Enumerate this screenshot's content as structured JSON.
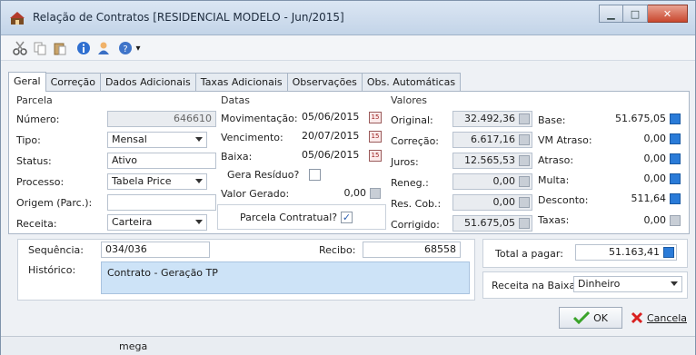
{
  "window": {
    "title": "Relação de Contratos [RESIDENCIAL MODELO - Jun/2015]",
    "controls": {
      "minimize": "▁",
      "maximize": "□",
      "close": "✕"
    }
  },
  "toolbar": {
    "icons": [
      "scissors-icon",
      "copy-icon",
      "paste-icon",
      "info-icon",
      "user-icon",
      "help-icon"
    ],
    "dropdown_glyph": "▾"
  },
  "tabs": [
    "Geral",
    "Correção",
    "Dados Adicionais",
    "Taxas Adicionais",
    "Observações",
    "Obs. Automáticas"
  ],
  "parcela": {
    "title": "Parcela",
    "numero_label": "Número:",
    "numero_value": "646610",
    "tipo_label": "Tipo:",
    "tipo_value": "Mensal",
    "status_label": "Status:",
    "status_value": "Ativo",
    "processo_label": "Processo:",
    "processo_value": "Tabela Price",
    "origem_label": "Origem (Parc.):",
    "origem_value": "",
    "receita_label": "Receita:",
    "receita_value": "Carteira"
  },
  "datas": {
    "title": "Datas",
    "movimentacao_label": "Movimentação:",
    "movimentacao_value": "05/06/2015",
    "vencimento_label": "Vencimento:",
    "vencimento_value": "20/07/2015",
    "baixa_label": "Baixa:",
    "baixa_value": "05/06/2015",
    "gera_residuo_label": "Gera Resíduo?",
    "valor_gerado_label": "Valor Gerado:",
    "valor_gerado_value": "0,00",
    "parcela_contratual_label": "Parcela Contratual?",
    "parcela_contratual_checked": "✓"
  },
  "valores": {
    "title": "Valores",
    "original_label": "Original:",
    "original_value": "32.492,36",
    "correcao_label": "Correção:",
    "correcao_value": "6.617,16",
    "juros_label": "Juros:",
    "juros_value": "12.565,53",
    "reneg_label": "Reneg.:",
    "reneg_value": "0,00",
    "rescob_label": "Res. Cob.:",
    "rescob_value": "0,00",
    "corrigido_label": "Corrigido:",
    "corrigido_value": "51.675,05",
    "base_label": "Base:",
    "base_value": "51.675,05",
    "vmatraso_label": "VM Atraso:",
    "vmatraso_value": "0,00",
    "atraso_label": "Atraso:",
    "atraso_value": "0,00",
    "multa_label": "Multa:",
    "multa_value": "0,00",
    "desconto_label": "Desconto:",
    "desconto_value": "511,64",
    "taxas_label": "Taxas:",
    "taxas_value": "0,00"
  },
  "lower": {
    "sequencia_label": "Sequência:",
    "sequencia_value": "034/036",
    "recibo_label": "Recibo:",
    "recibo_value": "68558",
    "historico_label": "Histórico:",
    "historico_value": "Contrato - Geração TP",
    "total_label": "Total a pagar:",
    "total_value": "51.163,41",
    "receita_baixa_label": "Receita na Baixa:",
    "receita_baixa_value": "Dinheiro"
  },
  "buttons": {
    "ok": "OK",
    "cancel": "Cancela"
  },
  "statusbar": {
    "user": "mega"
  },
  "colors": {
    "history_bg": "#cde3f7",
    "calc_blue": "#2a7bd8",
    "ok_green": "#3aa32a",
    "cancel_red": "#d92020"
  }
}
